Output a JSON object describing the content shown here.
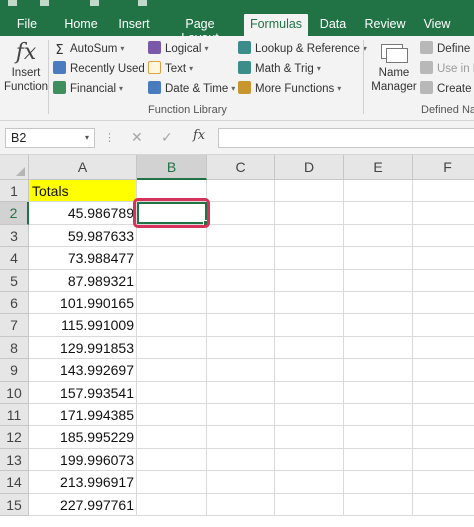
{
  "tabs": [
    {
      "label": "File",
      "active": false
    },
    {
      "label": "Home",
      "active": false
    },
    {
      "label": "Insert",
      "active": false
    },
    {
      "label": "Page Layout",
      "active": false
    },
    {
      "label": "Formulas",
      "active": true
    },
    {
      "label": "Data",
      "active": false
    },
    {
      "label": "Review",
      "active": false
    },
    {
      "label": "View",
      "active": false
    }
  ],
  "ribbon": {
    "insert_function": {
      "icon": "fx-icon",
      "label_line1": "Insert",
      "label_line2": "Function"
    },
    "function_library": {
      "label": "Function Library",
      "autosum": "AutoSum",
      "recently_used": "Recently Used",
      "financial": "Financial",
      "logical": "Logical",
      "text": "Text",
      "date_time": "Date & Time",
      "lookup_reference": "Lookup & Reference",
      "math_trig": "Math & Trig",
      "more_functions": "More Functions"
    },
    "defined_names": {
      "label": "Defined Na",
      "name_manager_line1": "Name",
      "name_manager_line2": "Manager",
      "define_name": "Define N",
      "use_in_formula": "Use in Fo",
      "create_from": "Create fr"
    }
  },
  "formula_bar": {
    "name_box": "B2",
    "cancel_symbol": "✕",
    "enter_symbol": "✓",
    "fx_symbol": "fx",
    "formula": ""
  },
  "sheet": {
    "columns": [
      "A",
      "B",
      "C",
      "D",
      "E",
      "F"
    ],
    "selected_column": "B",
    "selected_row": 2,
    "active_cell": "B2",
    "rows": [
      {
        "num": "1",
        "a": "Totals"
      },
      {
        "num": "2",
        "a": "45.986789"
      },
      {
        "num": "3",
        "a": "59.987633"
      },
      {
        "num": "4",
        "a": "73.988477"
      },
      {
        "num": "5",
        "a": "87.989321"
      },
      {
        "num": "6",
        "a": "101.990165"
      },
      {
        "num": "7",
        "a": "115.991009"
      },
      {
        "num": "8",
        "a": "129.991853"
      },
      {
        "num": "9",
        "a": "143.992697"
      },
      {
        "num": "10",
        "a": "157.993541"
      },
      {
        "num": "11",
        "a": "171.994385"
      },
      {
        "num": "12",
        "a": "185.995229"
      },
      {
        "num": "13",
        "a": "199.996073"
      },
      {
        "num": "14",
        "a": "213.996917"
      },
      {
        "num": "15",
        "a": "227.997761"
      }
    ]
  },
  "colors": {
    "accent": "#217346",
    "header_fill": "#ffff00",
    "highlight_ring": "#d6335a"
  }
}
